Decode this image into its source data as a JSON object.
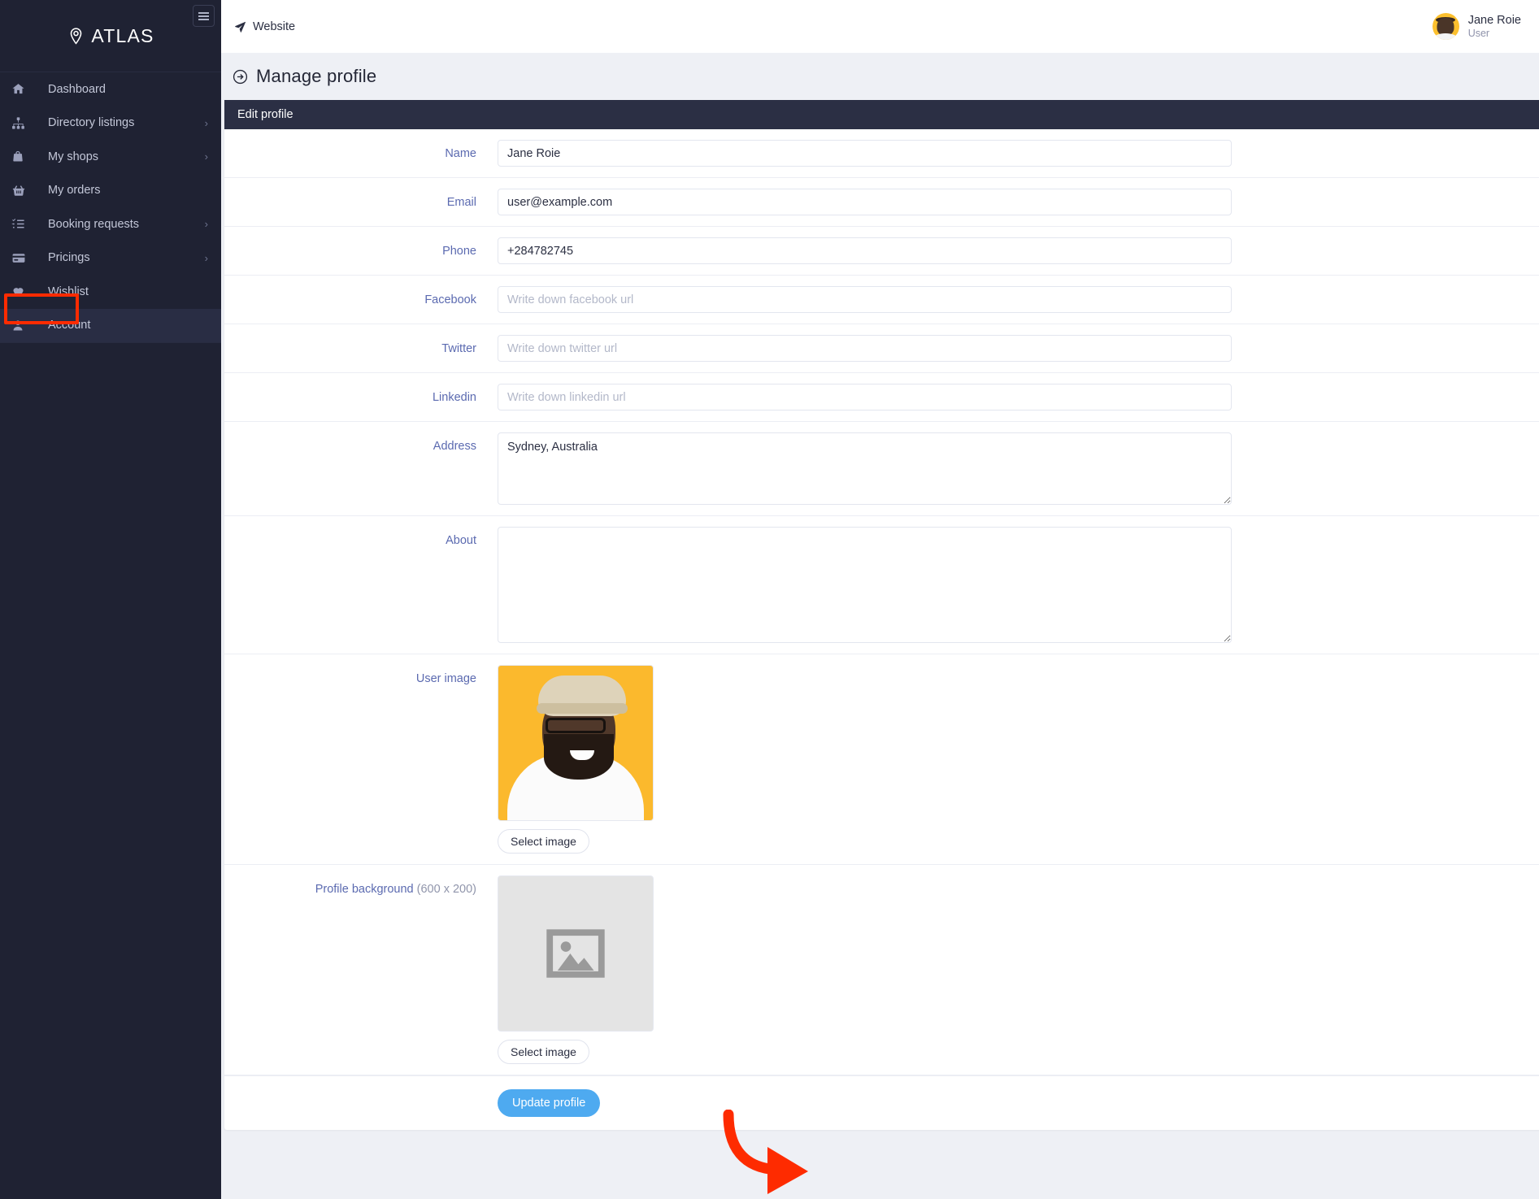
{
  "brand": {
    "name": "ATLAS",
    "logo_icon": "map-pin-icon",
    "toggle_icon": "hamburger-icon"
  },
  "sidebar": {
    "items": [
      {
        "label": "Dashboard",
        "icon": "home-icon",
        "chevron": "",
        "active": false
      },
      {
        "label": "Directory listings",
        "icon": "sitemap-icon",
        "chevron": "›",
        "active": false
      },
      {
        "label": "My shops",
        "icon": "bag-icon",
        "chevron": "›",
        "active": false
      },
      {
        "label": "My orders",
        "icon": "basket-icon",
        "chevron": "",
        "active": false
      },
      {
        "label": "Booking requests",
        "icon": "checklist-icon",
        "chevron": "›",
        "active": false
      },
      {
        "label": "Pricings",
        "icon": "credit-card-icon",
        "chevron": "›",
        "active": false
      },
      {
        "label": "Wishlist",
        "icon": "heart-icon",
        "chevron": "",
        "active": false
      },
      {
        "label": "Account",
        "icon": "user-icon",
        "chevron": "",
        "active": true
      }
    ],
    "highlight_color": "#fe2b00"
  },
  "topbar": {
    "website_label": "Website",
    "website_icon": "paper-plane-icon",
    "user": {
      "name": "Jane Roie",
      "role": "User",
      "avatar_icon": "user-avatar"
    }
  },
  "page": {
    "title": "Manage profile",
    "title_icon": "arrow-circle-right-icon"
  },
  "card": {
    "header": "Edit profile",
    "fields": [
      {
        "label": "Name",
        "value": "Jane Roie",
        "placeholder": "",
        "type": "text"
      },
      {
        "label": "Email",
        "value": "user@example.com",
        "placeholder": "",
        "type": "text"
      },
      {
        "label": "Phone",
        "value": "+284782745",
        "placeholder": "",
        "type": "text"
      },
      {
        "label": "Facebook",
        "value": "",
        "placeholder": "Write down facebook url",
        "type": "text"
      },
      {
        "label": "Twitter",
        "value": "",
        "placeholder": "Write down twitter url",
        "type": "text"
      },
      {
        "label": "Linkedin",
        "value": "",
        "placeholder": "Write down linkedin url",
        "type": "text"
      },
      {
        "label": "Address",
        "value": "Sydney, Australia",
        "placeholder": "",
        "type": "textarea-address"
      },
      {
        "label": "About",
        "value": "",
        "placeholder": "",
        "type": "textarea-about"
      }
    ],
    "user_image": {
      "label": "User image",
      "select_label": "Select image",
      "image_icon": "user-photo-thumbnail"
    },
    "profile_background": {
      "label": "Profile background",
      "label_note": "(600 x 200)",
      "select_label": "Select image",
      "image_icon": "image-placeholder-icon"
    },
    "submit_label": "Update profile",
    "submit_color": "#4eaaf0"
  },
  "annotation": {
    "arrow_icon": "red-curved-arrow",
    "arrow_color": "#fe2b00"
  }
}
